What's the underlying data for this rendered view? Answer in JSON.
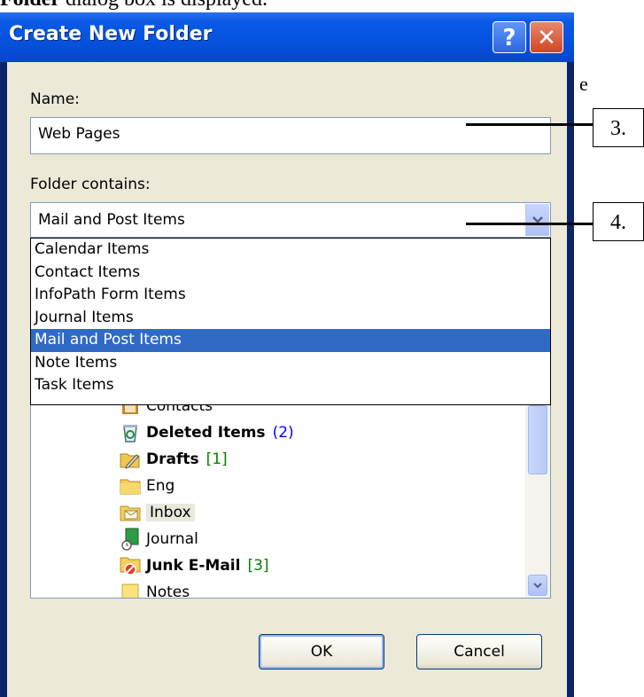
{
  "document": {
    "fragment_bold": "Folder",
    "fragment_rest": " dialog box is displayed.",
    "fragment_right": "e"
  },
  "dialog": {
    "title": "Create New Folder",
    "help_glyph": "?",
    "close_glyph": "✕",
    "name_label": "Name:",
    "name_value": "Web Pages",
    "contains_label": "Folder contains:",
    "contains_value": "Mail and Post Items",
    "dropdown_options": [
      "Calendar Items",
      "Contact Items",
      "InfoPath Form Items",
      "Journal Items",
      "Mail and Post Items",
      "Note Items",
      "Task Items"
    ],
    "selected_option": "Mail and Post Items",
    "tree_items": [
      {
        "name": "Contacts",
        "icon": "contacts-icon",
        "bold": false,
        "count": ""
      },
      {
        "name": "Deleted Items",
        "icon": "recycle-bin-icon",
        "bold": true,
        "count": "(2)"
      },
      {
        "name": "Drafts",
        "icon": "drafts-icon",
        "bold": true,
        "count": "[1]"
      },
      {
        "name": "Eng",
        "icon": "folder-icon",
        "bold": false,
        "count": ""
      },
      {
        "name": "Inbox",
        "icon": "inbox-folder-icon",
        "bold": false,
        "count": ""
      },
      {
        "name": "Journal",
        "icon": "journal-icon",
        "bold": false,
        "count": ""
      },
      {
        "name": "Junk E-Mail",
        "icon": "junk-mail-icon",
        "bold": true,
        "count": "[3]"
      },
      {
        "name": "Notes",
        "icon": "notes-icon",
        "bold": false,
        "count": ""
      }
    ],
    "ok_label": "OK",
    "cancel_label": "Cancel"
  },
  "callouts": [
    "3.",
    "4."
  ],
  "colors": {
    "titlebar": "#0553e0",
    "selection": "#316ac5",
    "dialog_face": "#ece9d8",
    "count_blue": "#0000ff",
    "count_green": "#008000"
  }
}
